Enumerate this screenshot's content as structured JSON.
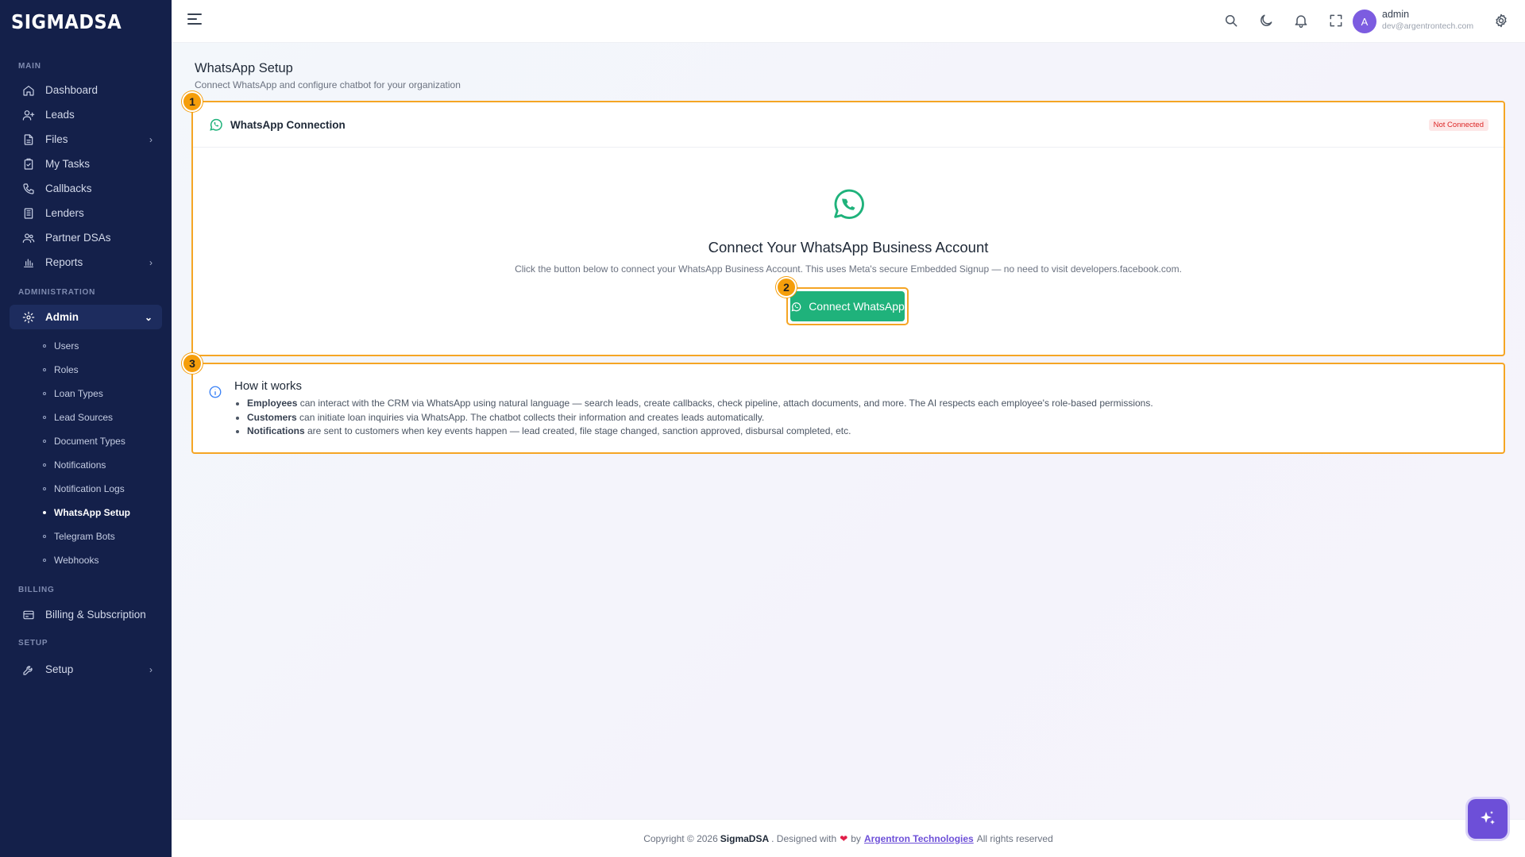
{
  "brand": {
    "logo_text": "SIGMADSA"
  },
  "sidebar": {
    "sections": {
      "main": "MAIN",
      "administration": "ADMINISTRATION",
      "billing": "BILLING",
      "setup": "SETUP"
    },
    "main_items": [
      {
        "label": "Dashboard",
        "icon": "home-icon"
      },
      {
        "label": "Leads",
        "icon": "user-plus-icon"
      },
      {
        "label": "Files",
        "icon": "file-icon"
      },
      {
        "label": "My Tasks",
        "icon": "tasks-icon"
      },
      {
        "label": "Callbacks",
        "icon": "phone-icon"
      },
      {
        "label": "Lenders",
        "icon": "building-icon"
      },
      {
        "label": "Partner DSAs",
        "icon": "users-icon"
      },
      {
        "label": "Reports",
        "icon": "bar-chart-icon"
      }
    ],
    "admin_label": "Admin",
    "admin_sub_items": [
      "Users",
      "Roles",
      "Loan Types",
      "Lead Sources",
      "Document Types",
      "Notifications",
      "Notification Logs",
      "WhatsApp Setup",
      "Telegram Bots",
      "Webhooks"
    ],
    "active_sub_item": "WhatsApp Setup",
    "billing_label": "Billing & Subscription",
    "setup_label": "Setup"
  },
  "header": {
    "user_initial": "A",
    "user_name": "admin",
    "user_email": "dev@argentrontech.com"
  },
  "page": {
    "title": "WhatsApp Setup",
    "subtitle": "Connect WhatsApp and configure chatbot for your organization"
  },
  "markers": [
    "1",
    "2",
    "3"
  ],
  "connection_card": {
    "title": "WhatsApp Connection",
    "status": "Not Connected",
    "status_color": "#dc2626",
    "hero_title": "Connect Your WhatsApp Business Account",
    "hero_desc": "Click the button below to connect your WhatsApp Business Account. This uses Meta's secure Embedded Signup — no need to visit developers.facebook.com.",
    "button_label": "Connect WhatsApp",
    "button_color": "#1fb27b"
  },
  "how_it_works": {
    "title": "How it works",
    "items": [
      {
        "bold": "Employees",
        "text": " can interact with the CRM via WhatsApp using natural language — search leads, create callbacks, check pipeline, attach documents, and more. The AI respects each employee's role-based permissions."
      },
      {
        "bold": "Customers",
        "text": " can initiate loan inquiries via WhatsApp. The chatbot collects their information and creates leads automatically."
      },
      {
        "bold": "Notifications",
        "text": " are sent to customers when key events happen — lead created, file stage changed, sanction approved, disbursal completed, etc."
      }
    ]
  },
  "footer": {
    "prefix": "Copyright © 2026",
    "brand": "SigmaDSA",
    "designed": ". Designed with",
    "by": "by",
    "company": "Argentron Technologies",
    "suffix": "All rights reserved"
  },
  "colors": {
    "sidebar_bg": "#14204a",
    "accent": "#6d4fd8",
    "highlight": "#f5a524"
  }
}
